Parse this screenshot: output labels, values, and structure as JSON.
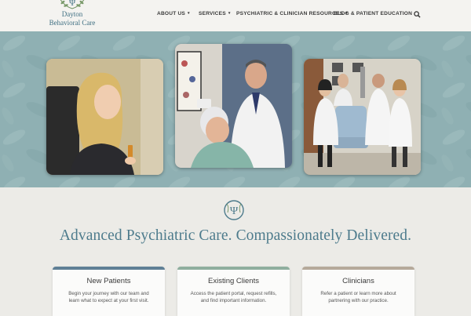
{
  "brand": {
    "name_line1": "Dayton",
    "name_line2": "Behavioral Care",
    "primary_color": "#3f6f82"
  },
  "nav": {
    "items": [
      {
        "label": "ABOUT US",
        "has_dropdown": true
      },
      {
        "label": "SERVICES",
        "has_dropdown": true
      },
      {
        "label": "PSYCHIATRIC & CLINICIAN RESOURCES",
        "has_dropdown": true
      },
      {
        "label": "BLOG & PATIENT EDUCATION",
        "has_dropdown": false
      }
    ],
    "chevron_glyph": "▾",
    "search_icon": "search-icon"
  },
  "hero": {
    "background_color": "#8fb0b3",
    "photos": [
      {
        "icon": "photo-patient-woman"
      },
      {
        "icon": "photo-doctor-treating-patient"
      },
      {
        "icon": "photo-clinical-staff-group"
      }
    ]
  },
  "main": {
    "emblem_icon": "psi-emblem-icon",
    "headline": "Advanced Psychiatric Care. Compassionately Delivered."
  },
  "cards": [
    {
      "title": "New Patients",
      "text": "Begin your journey with our team and\nlearn what to expect at your first visit.",
      "accent": "#5f7f95"
    },
    {
      "title": "Existing Clients",
      "text": "Access the patient portal, request refills,\nand find important information.",
      "accent": "#8fae9e"
    },
    {
      "title": "Clinicians",
      "text": "Refer a patient or learn more about\npartnering with our practice.",
      "accent": "#b5a99a"
    }
  ]
}
